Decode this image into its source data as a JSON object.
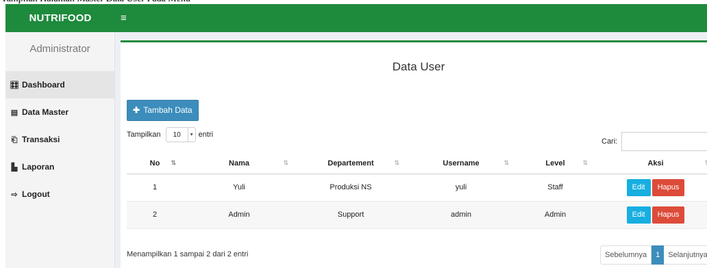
{
  "header": {
    "brand": "NUTRIFOOD",
    "menu_icon": "hamburger-icon",
    "accent_color": "#1e8a3c"
  },
  "sidebar": {
    "user_label": "Administrator",
    "items": [
      {
        "label": "Dashboard",
        "icon": "dashboard-icon",
        "glyph": "🎛",
        "active": true
      },
      {
        "label": "Data Master",
        "icon": "archive-box-icon",
        "glyph": "▤",
        "active": false
      },
      {
        "label": "Transaksi",
        "icon": "transaction-icon",
        "glyph": "⎗",
        "active": false
      },
      {
        "label": "Laporan",
        "icon": "file-icon",
        "glyph": "▙",
        "active": false
      },
      {
        "label": "Logout",
        "icon": "logout-icon",
        "glyph": "⇨",
        "active": false
      }
    ]
  },
  "main": {
    "title": "Data User",
    "add_button": "Tambah Data",
    "length": {
      "prefix": "Tampilkan",
      "value": "10",
      "suffix": "entri"
    },
    "search_label": "Cari:",
    "table": {
      "columns": [
        "No",
        "Nama",
        "Departement",
        "Username",
        "Level",
        "Aksi"
      ],
      "rows": [
        {
          "no": "1",
          "nama": "Yuli",
          "departement": "Produksi NS",
          "username": "yuli",
          "level": "Staff"
        },
        {
          "no": "2",
          "nama": "Admin",
          "departement": "Support",
          "username": "admin",
          "level": "Admin"
        }
      ],
      "edit_label": "Edit",
      "delete_label": "Hapus"
    },
    "info": "Menampilkan 1 sampai 2 dari 2 entri",
    "pagination": {
      "prev": "Sebelumnya",
      "current": "1",
      "next": "Selanjutnya"
    }
  }
}
